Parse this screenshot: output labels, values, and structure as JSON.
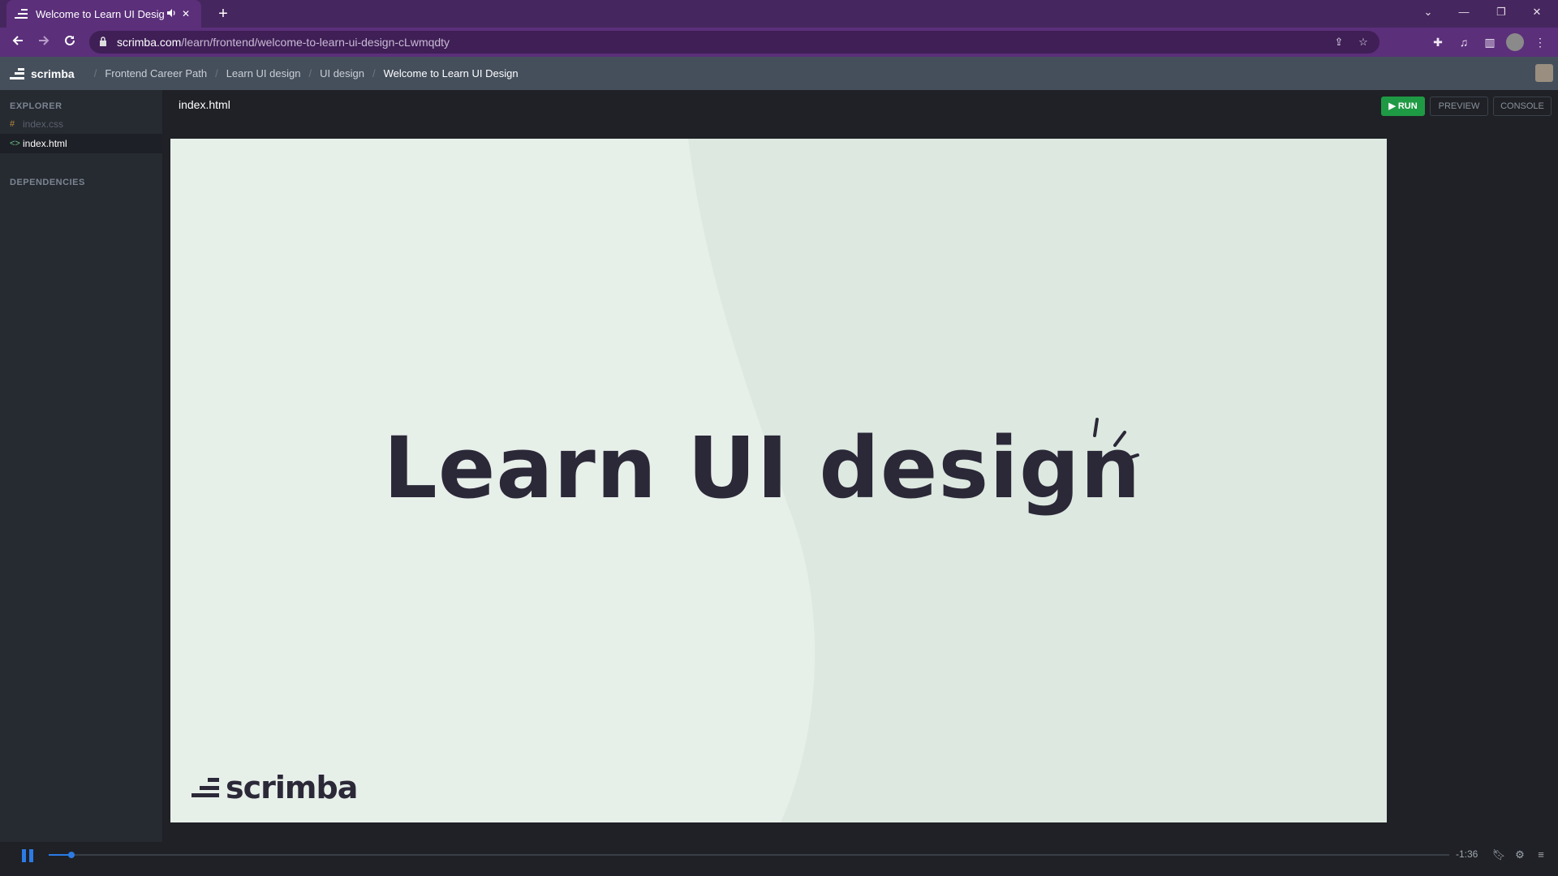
{
  "browser": {
    "tab_title": "Welcome to Learn UI Design",
    "tab_audio_icon": "speaker-icon",
    "tab_close": "✕",
    "new_tab": "+",
    "url_host": "scrimba.com",
    "url_path": "/learn/frontend/welcome-to-learn-ui-design-cLwmqdty",
    "window_controls": {
      "dropdown": "⌄",
      "minimize": "—",
      "restore": "❐",
      "close": "✕"
    }
  },
  "header": {
    "brand": "scrimba",
    "breadcrumbs": [
      "Frontend Career Path",
      "Learn UI design",
      "UI design"
    ],
    "current": "Welcome to Learn UI Design"
  },
  "sidebar": {
    "explorer_title": "EXPLORER",
    "files": [
      {
        "name": "index.css",
        "icon": "#"
      },
      {
        "name": "index.html",
        "icon": "<>"
      }
    ],
    "dependencies_title": "DEPENDENCIES"
  },
  "editor": {
    "active_file": "index.html",
    "run_label": "▶ RUN",
    "preview_label": "PREVIEW",
    "console_label": "CONSOLE"
  },
  "slide": {
    "headline": "Learn UI design",
    "logo_text": "scrimba",
    "colors": {
      "background": "#e7efe9",
      "accent_shape": "#dde9e0",
      "text": "#2b2838"
    }
  },
  "player": {
    "time_remaining": "-1:36",
    "progress": 0.015,
    "accent": "#2c7be5"
  }
}
